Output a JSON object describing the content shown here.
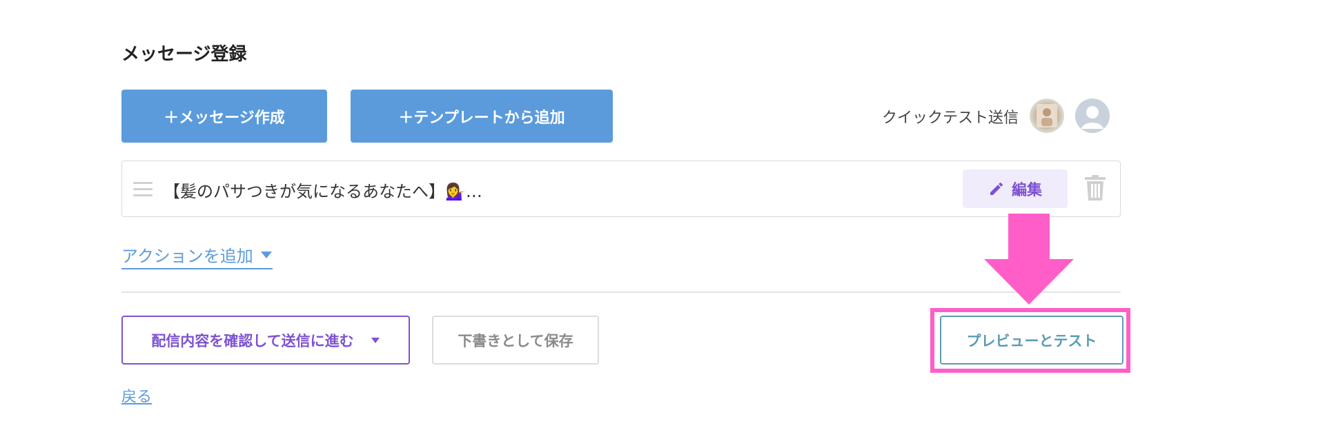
{
  "page": {
    "title": "メッセージ登録"
  },
  "toolbar": {
    "create_label": "＋メッセージ作成",
    "template_label": "＋テンプレートから追加",
    "quick_test_label": "クイックテスト送信"
  },
  "message": {
    "preview_text": "【髪のパサつきが気になるあなたへ】💁‍♀️…",
    "edit_label": "編集"
  },
  "actions": {
    "add_action_label": "アクションを追加"
  },
  "footer": {
    "confirm_label": "配信内容を確認して送信に進む",
    "draft_label": "下書きとして保存",
    "preview_label": "プレビューとテスト",
    "back_label": "戻る"
  },
  "colors": {
    "primary_blue": "#5b9bdc",
    "purple": "#7d51d1",
    "highlight_pink": "#ff5ec8",
    "preview_teal": "#5a9bb4"
  },
  "icons": [
    "plus-icon",
    "drag-handle-icon",
    "pencil-icon",
    "trash-icon",
    "caret-down-icon",
    "down-arrow-annotation"
  ]
}
